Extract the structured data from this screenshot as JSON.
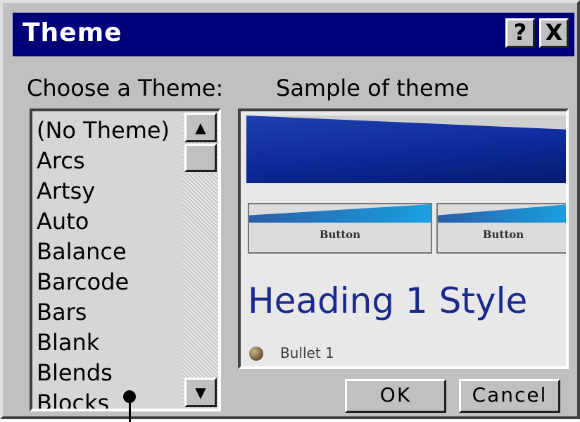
{
  "window": {
    "title": "Theme",
    "help_label": "?",
    "close_label": "X"
  },
  "list": {
    "label": "Choose a Theme:",
    "items": [
      "(No Theme)",
      "Arcs",
      "Artsy",
      "Auto",
      "Balance",
      "Barcode",
      "Bars",
      "Blank",
      "Blends",
      "Blocks"
    ],
    "scroll_up_icon": "▲",
    "scroll_down_icon": "▼"
  },
  "sample": {
    "label": "Sample of theme",
    "button_label": "Button",
    "heading": "Heading 1 Style",
    "bullet": "Bullet 1"
  },
  "buttons": {
    "ok": "OK",
    "cancel": "Cancel"
  },
  "colors": {
    "title_bar": "#00007a",
    "heading": "#1a2a8c",
    "face": "#c0c0c0"
  }
}
